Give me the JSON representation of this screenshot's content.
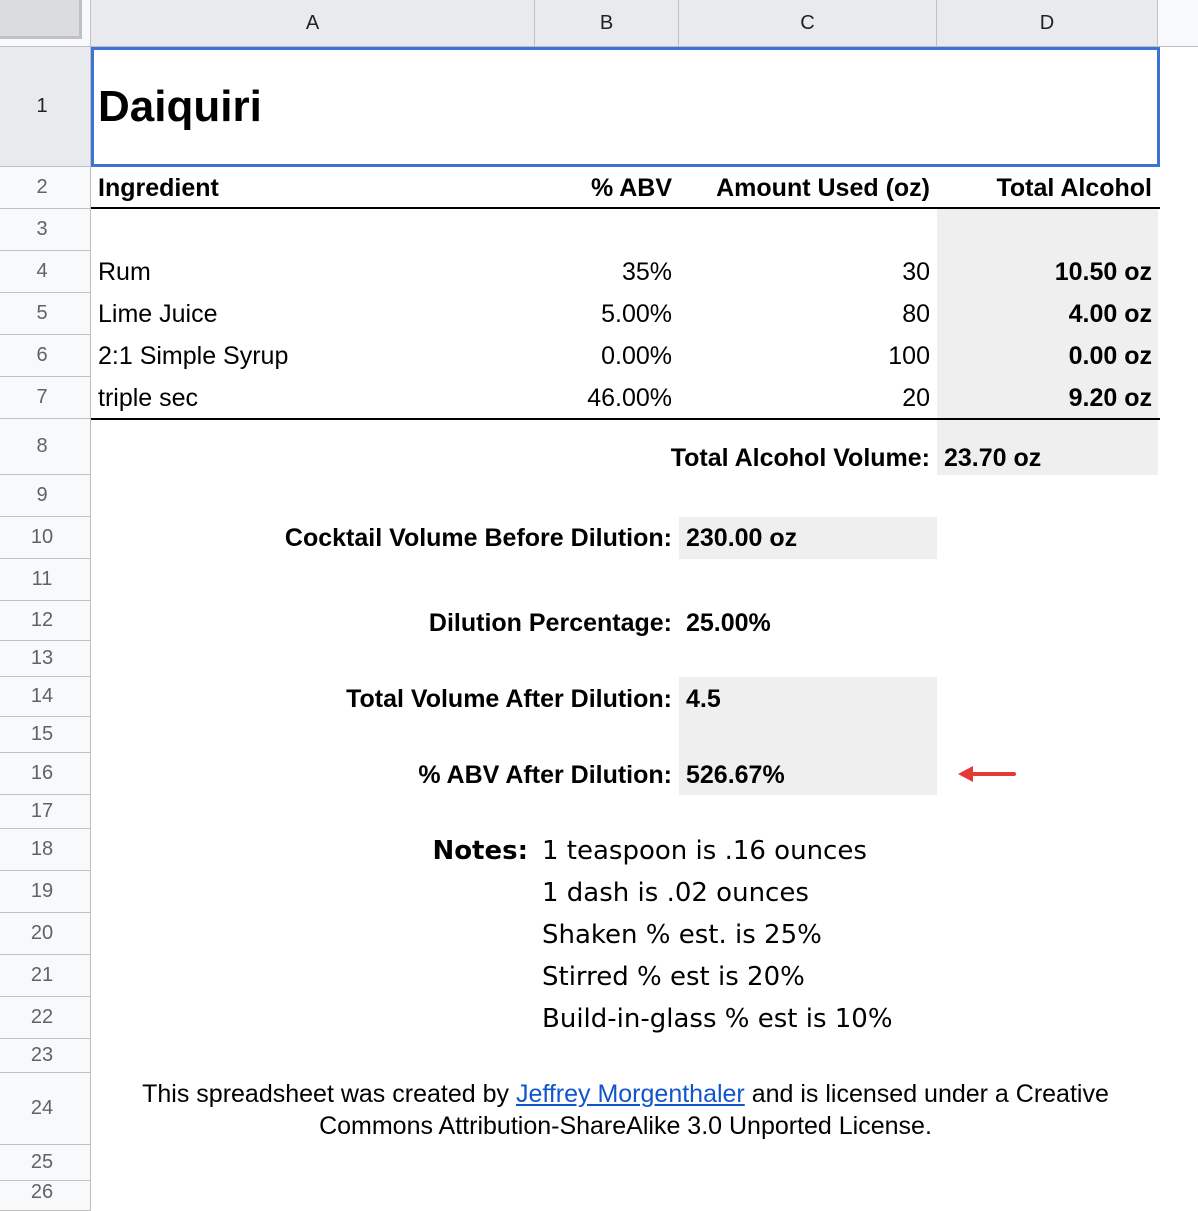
{
  "columns": [
    "A",
    "B",
    "C",
    "D"
  ],
  "rows": [
    "1",
    "2",
    "3",
    "4",
    "5",
    "6",
    "7",
    "8",
    "9",
    "10",
    "11",
    "12",
    "13",
    "14",
    "15",
    "16",
    "17",
    "18",
    "19",
    "20",
    "21",
    "22",
    "23",
    "24",
    "25",
    "26"
  ],
  "title": "Daiquiri",
  "headers": {
    "ingredient": "Ingredient",
    "abv": "% ABV",
    "amount": "Amount Used (oz)",
    "total": "Total Alcohol"
  },
  "ingredients": [
    {
      "name": "Rum",
      "abv": "35%",
      "amount": "30",
      "total": "10.50 oz"
    },
    {
      "name": "Lime Juice",
      "abv": "5.00%",
      "amount": "80",
      "total": "4.00 oz"
    },
    {
      "name": "2:1 Simple Syrup",
      "abv": "0.00%",
      "amount": "100",
      "total": "0.00 oz"
    },
    {
      "name": "triple sec",
      "abv": "46.00%",
      "amount": "20",
      "total": "9.20 oz"
    }
  ],
  "summary": {
    "total_alcohol_label": "Total Alcohol Volume:",
    "total_alcohol_value": "23.70 oz",
    "before_dilution_label": "Cocktail Volume Before Dilution:",
    "before_dilution_value": "230.00 oz",
    "dilution_pct_label": "Dilution Percentage:",
    "dilution_pct_value": "25.00%",
    "after_dilution_label": "Total Volume After Dilution:",
    "after_dilution_value": "4.5",
    "abv_after_label": "% ABV After Dilution:",
    "abv_after_value": "526.67%"
  },
  "notes": {
    "label": "Notes:",
    "lines": [
      "1 teaspoon is .16 ounces",
      "1 dash is .02 ounces",
      "Shaken % est. is 25%",
      "Stirred % est is 20%",
      "Build-in-glass % est is 10%"
    ]
  },
  "footer": {
    "prefix": "This spreadsheet was created by ",
    "author_link": "Jeffrey Morgenthaler",
    "suffix": " and is licensed under a Creative Commons Attribution-ShareAlike 3.0 Unported License."
  },
  "colors": {
    "selection": "#3d73d6",
    "shade": "#efefef",
    "arrow": "#e53935",
    "link": "#1155cc"
  },
  "icons": {
    "annotation": "red-arrow-left-icon"
  }
}
